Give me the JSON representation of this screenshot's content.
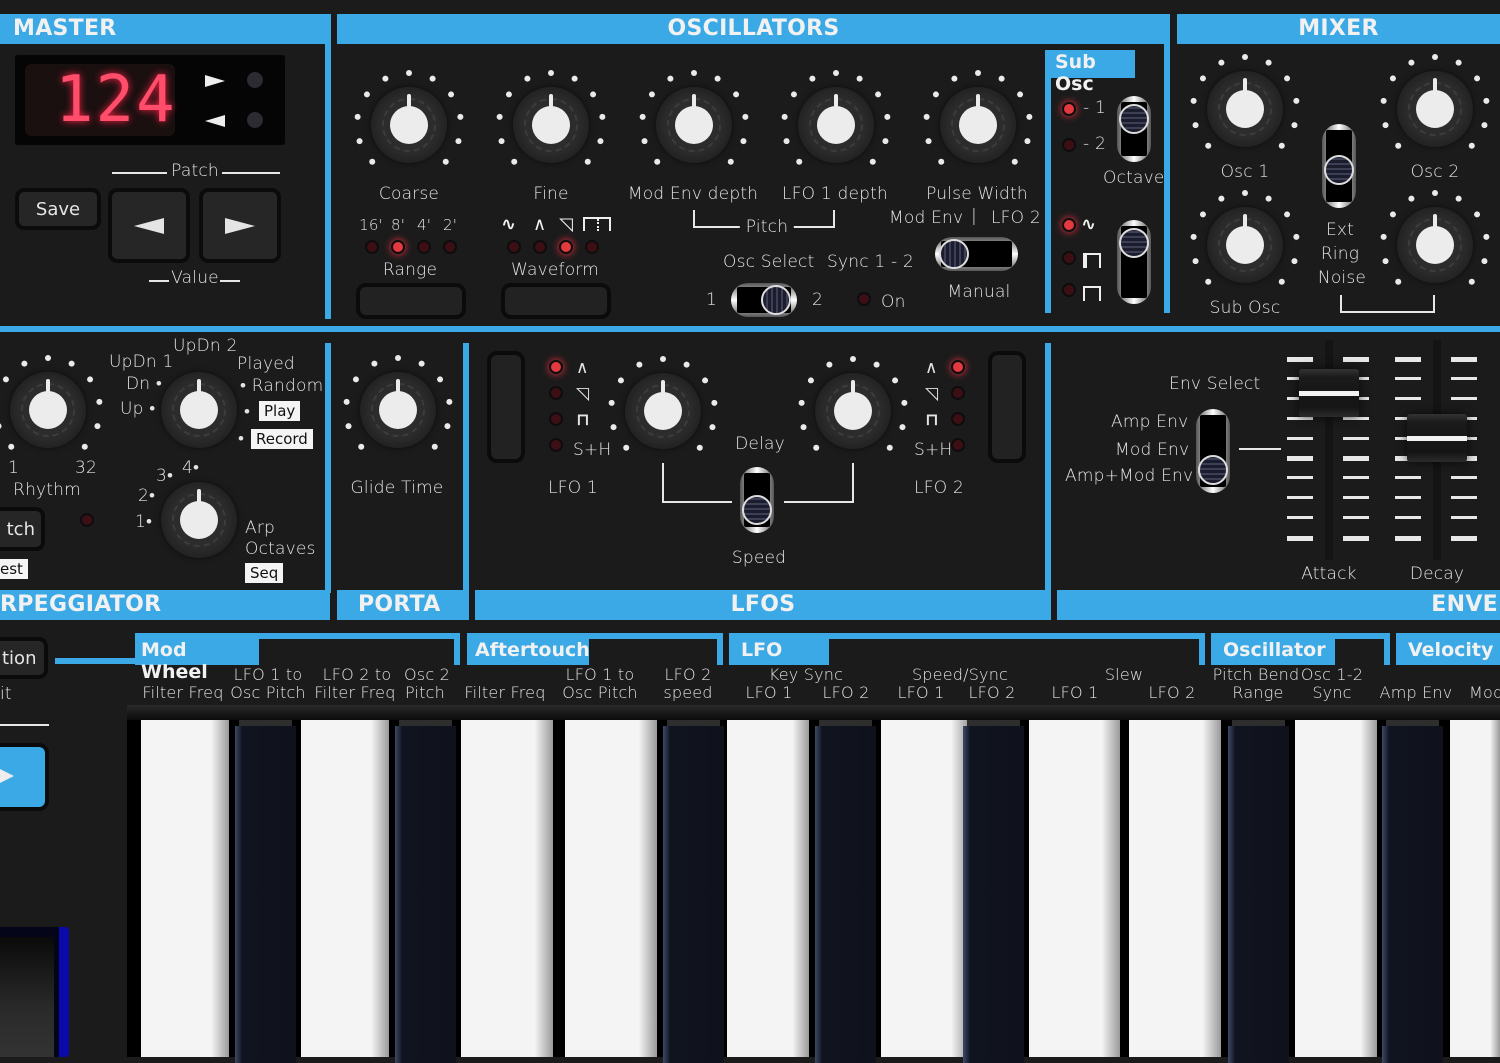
{
  "master": {
    "header": "MASTER",
    "display_value": "124",
    "patch_label": "Patch",
    "value_label": "Value",
    "save_label": "Save",
    "up_indicator": "right-arrow",
    "down_indicator": "left-arrow"
  },
  "oscillators": {
    "header": "OSCILLATORS",
    "knobs": [
      "Coarse",
      "Fine",
      "Mod Env depth",
      "LFO 1 depth",
      "Pulse Width"
    ],
    "range": {
      "label": "Range",
      "options": [
        "16'",
        "8'",
        "4'",
        "2'"
      ],
      "selected": "8'"
    },
    "waveform": {
      "label": "Waveform",
      "options": [
        "sine",
        "triangle",
        "sawtooth",
        "pulse"
      ],
      "selected": "sawtooth"
    },
    "pitch_label": "Pitch",
    "pulse_mod": {
      "left": "Mod Env",
      "sep": "|",
      "right": "LFO 2",
      "manual": "Manual"
    },
    "osc_select": {
      "label": "Osc Select",
      "left": "1",
      "right": "2",
      "value": "2"
    },
    "sync": {
      "label": "Sync 1 - 2",
      "on_label": "On",
      "on": false
    }
  },
  "sub_osc": {
    "header": "Sub Osc",
    "octave": {
      "label": "Octave",
      "options": [
        "- 1",
        "- 2"
      ],
      "selected": "- 1"
    },
    "wave": {
      "options": [
        "sine",
        "pulse-wide",
        "pulse-narrow"
      ],
      "selected": "sine"
    }
  },
  "mixer": {
    "header": "MIXER",
    "knobs": [
      "Osc 1",
      "Osc 2",
      "Sub Osc",
      ""
    ],
    "switch_options": [
      "Ext",
      "Ring",
      "Noise"
    ]
  },
  "arpeggiator": {
    "header": "RPEGGIATOR",
    "rhythm": {
      "label": "Rhythm",
      "min": "1",
      "max": "32"
    },
    "mode_labels": [
      "Up",
      "Dn",
      "UpDn 1",
      "UpDn 2",
      "Played",
      "Random"
    ],
    "play_tag": "Play",
    "record_tag": "Record",
    "octave_labels": [
      "1",
      "2",
      "3",
      "4"
    ],
    "arp_octaves_label": [
      "Arp",
      "Octaves"
    ],
    "seq_tag": "Seq",
    "latch_label": "tch",
    "test_tag": "est"
  },
  "porta": {
    "header": "PORTA",
    "knob": "Glide Time"
  },
  "lfos": {
    "header": "LFOS",
    "lfo1": {
      "label": "LFO 1",
      "waves": [
        "triangle",
        "sawtooth",
        "square",
        "S+H"
      ],
      "selected": "triangle"
    },
    "lfo2": {
      "label": "LFO 2",
      "waves": [
        "triangle",
        "sawtooth",
        "square",
        "S+H"
      ],
      "selected": "triangle"
    },
    "delay_label": "Delay",
    "speed_label": "Speed",
    "sh_label": "S+H"
  },
  "envelope": {
    "header": "ENVE",
    "env_select_label": "Env Select",
    "env_options": [
      "Amp Env",
      "Mod Env",
      "Amp+Mod Env"
    ],
    "selected": "Amp+Mod Env",
    "faders": [
      {
        "label": "Attack",
        "value": 0.8
      },
      {
        "label": "Decay",
        "value": 0.55
      }
    ]
  },
  "left_panel": {
    "button1": "tion",
    "text": "it"
  },
  "performance": {
    "groups": [
      {
        "title": "Mod Wheel",
        "items": [
          [
            "",
            "Filter Freq"
          ],
          [
            "LFO 1 to",
            "Osc Pitch"
          ],
          [
            "LFO 2 to",
            "Filter Freq"
          ],
          [
            "Osc 2",
            "Pitch"
          ]
        ]
      },
      {
        "title": "Aftertouch",
        "items": [
          [
            "",
            "Filter Freq"
          ],
          [
            "LFO 1 to",
            "Osc Pitch"
          ],
          [
            "LFO 2",
            "speed"
          ]
        ]
      },
      {
        "title": "LFO",
        "subgroups": [
          {
            "title": "Key Sync",
            "items": [
              "LFO 1",
              "LFO 2"
            ]
          },
          {
            "title": "Speed/Sync",
            "items": [
              "LFO 1",
              "LFO 2"
            ]
          },
          {
            "title": "Slew",
            "items": [
              "LFO 1",
              "LFO 2"
            ]
          }
        ]
      },
      {
        "title": "Oscillator",
        "items": [
          [
            "Pitch Bend",
            "Range"
          ],
          [
            "Osc 1-2",
            "Sync"
          ]
        ]
      },
      {
        "title": "Velocity",
        "items": [
          [
            "",
            "Amp Env"
          ],
          [
            "",
            "Mod"
          ]
        ]
      }
    ]
  },
  "colors": {
    "accent": "#3aa9e6",
    "background": "#1b1b1b",
    "led_on": "#e23a3f",
    "led_off": "#3d0f14",
    "display": "#ff4466"
  }
}
